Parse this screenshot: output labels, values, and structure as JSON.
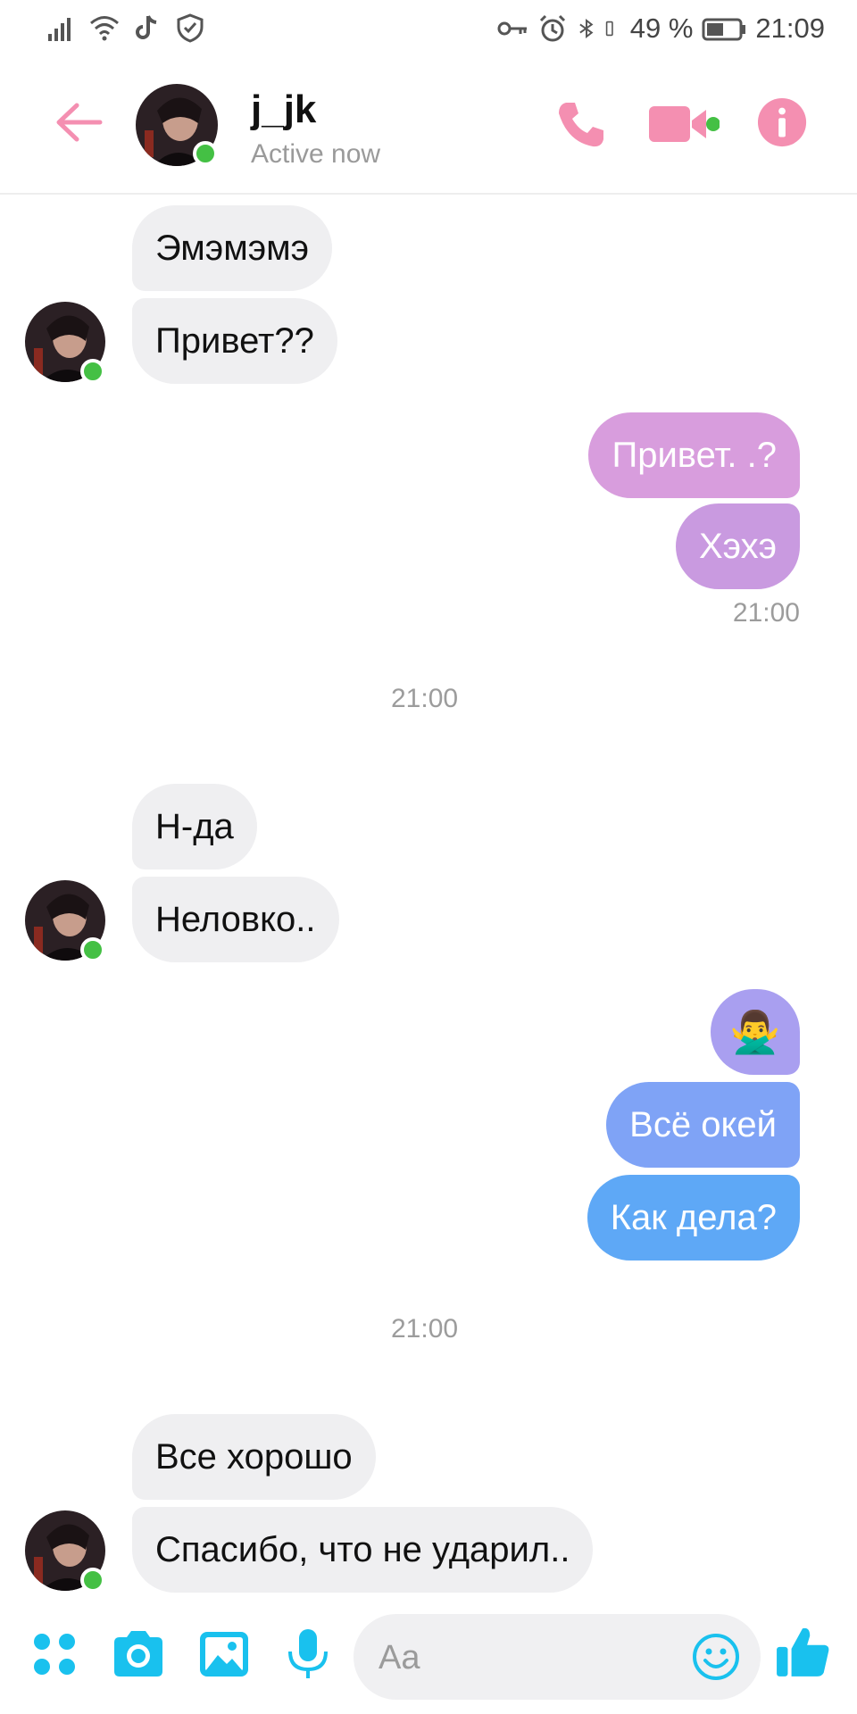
{
  "status_bar": {
    "battery": "49 %",
    "time": "21:09",
    "icons": [
      "signal-icon",
      "wifi-icon",
      "tiktok-icon",
      "shield-check-icon",
      "key-icon",
      "alarm-icon",
      "bluetooth-icon",
      "vibrate-icon",
      "battery-icon"
    ]
  },
  "header": {
    "contact_name": "j_jk",
    "status": "Active now",
    "accent_color": "#f48fb1",
    "online_color": "#44c044"
  },
  "messages": [
    {
      "side": "in",
      "text": "Эмэмэмэ"
    },
    {
      "side": "in",
      "text": "Привет??"
    },
    {
      "side": "out",
      "text": "Привет. .?",
      "color": "#d79bdc"
    },
    {
      "side": "out",
      "text": "Хэхэ",
      "color": "#cc9ae0"
    },
    {
      "side": "out_time",
      "text": "21:00"
    },
    {
      "side": "center_time",
      "text": "21:00"
    },
    {
      "side": "in",
      "text": "Н-да"
    },
    {
      "side": "in",
      "text": "Неловко.."
    },
    {
      "side": "out",
      "text": "🙅‍♂️",
      "color": "#a99ff0"
    },
    {
      "side": "out",
      "text": "Всё окей",
      "color": "#7fa3f6"
    },
    {
      "side": "out",
      "text": "Как дела?",
      "color": "#5ea8f6"
    },
    {
      "side": "center_time",
      "text": "21:00"
    },
    {
      "side": "in",
      "text": "Все хорошо"
    },
    {
      "side": "in",
      "text": "Спасибо, что не ударил.."
    }
  ],
  "composer": {
    "placeholder": "Aa",
    "icons": [
      "apps-icon",
      "camera-icon",
      "gallery-icon",
      "microphone-icon",
      "emoji-icon",
      "thumbs-up-icon"
    ],
    "icon_color": "#19c1ee"
  }
}
